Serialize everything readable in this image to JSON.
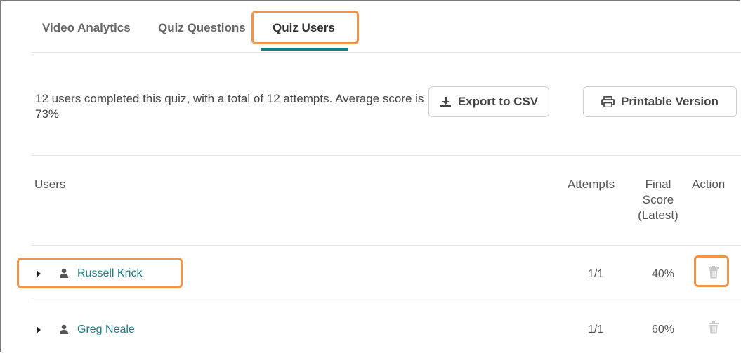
{
  "tabs": {
    "video_analytics": "Video Analytics",
    "quiz_questions": "Quiz Questions",
    "quiz_users": "Quiz Users"
  },
  "summary": {
    "text": "12 users completed this quiz, with a total of 12 attempts. Average score is 73%"
  },
  "toolbar": {
    "export_label": "Export to CSV",
    "export_icon": "download-icon",
    "print_label": "Printable Version",
    "print_icon": "printer-icon"
  },
  "table": {
    "headers": {
      "users": "Users",
      "attempts": "Attempts",
      "final_score": "Final Score (Latest)",
      "action": "Action"
    },
    "rows": [
      {
        "name": "Russell Krick",
        "attempts": "1/1",
        "score": "40%"
      },
      {
        "name": "Greg Neale",
        "attempts": "1/1",
        "score": "60%"
      }
    ]
  },
  "colors": {
    "accent": "#1b7c86",
    "highlight": "#f0954c",
    "border": "#cfcfcf"
  }
}
